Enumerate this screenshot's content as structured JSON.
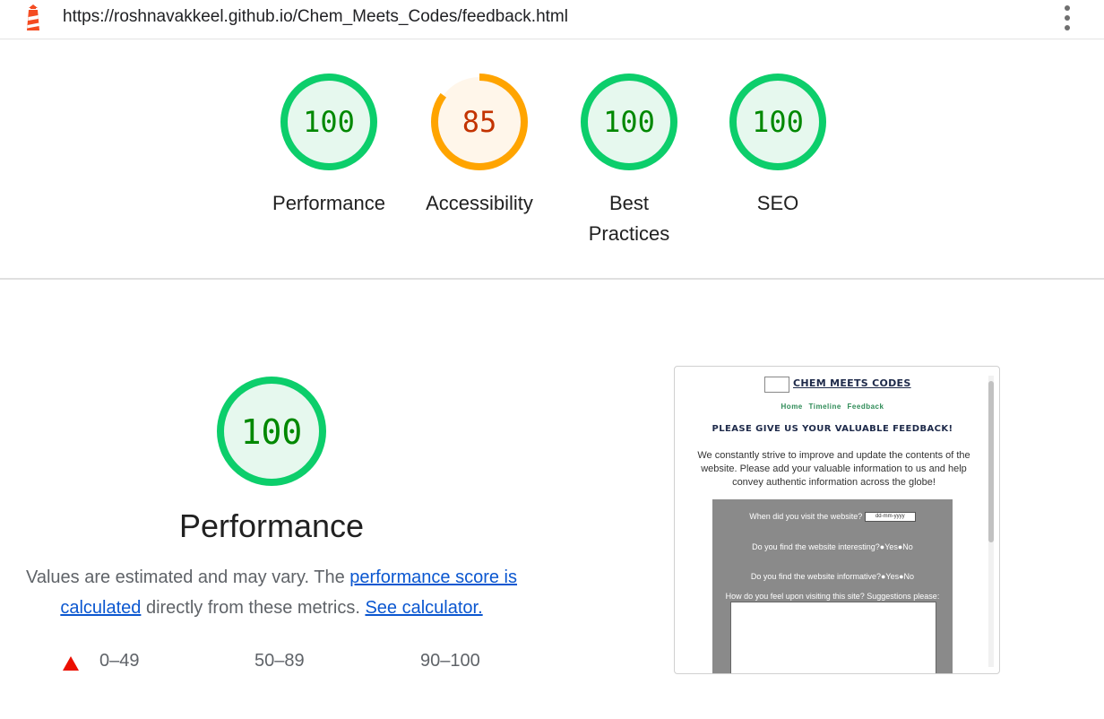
{
  "browser": {
    "url": "https://roshnavakkeel.github.io/Chem_Meets_Codes/feedback.html",
    "app_icon": "lighthouse-icon",
    "menu_icon": "more-vert-icon"
  },
  "summary_gauges": [
    {
      "label": "Performance",
      "score": "100",
      "value": 100,
      "color": "#0cce6b",
      "fill": "#e6f8ee",
      "text_color": "#008800"
    },
    {
      "label": "Accessibility",
      "score": "85",
      "value": 85,
      "color": "#ffa400",
      "fill": "#fff6ea",
      "text_color": "#c33300"
    },
    {
      "label_lines": [
        "Best",
        "Practices"
      ],
      "score": "100",
      "value": 100,
      "color": "#0cce6b",
      "fill": "#e6f8ee",
      "text_color": "#008800"
    },
    {
      "label": "SEO",
      "score": "100",
      "value": 100,
      "color": "#0cce6b",
      "fill": "#e6f8ee",
      "text_color": "#008800"
    }
  ],
  "performance": {
    "score": "100",
    "title": "Performance",
    "desc_prefix": "Values are estimated and may vary. The ",
    "desc_link1": "performance score is calculated",
    "desc_mid": " directly from these metrics. ",
    "desc_link2": "See calculator."
  },
  "legend": {
    "fail": "0–49",
    "average": "50–89",
    "pass": "90–100",
    "fail_color": "#eb0f00"
  },
  "screenshot": {
    "site_title": "CHEM MEETS CODES",
    "nav": [
      "Home",
      "Timeline",
      "Feedback"
    ],
    "heading": "PLEASE GIVE US YOUR VALUABLE FEEDBACK!",
    "intro": "We constantly strive to improve and update the contents of the website. Please add your valuable information to us and help convey authentic information across the globe!",
    "q1": "When did you visit the website?",
    "date_placeholder": "dd-mm-yyyy",
    "q2": "Do you find the website interesting?●Yes●No",
    "q3": "Do you find the website informative?●Yes●No",
    "q4": "How do you feel upon visiting this site? Suggestions please:"
  }
}
